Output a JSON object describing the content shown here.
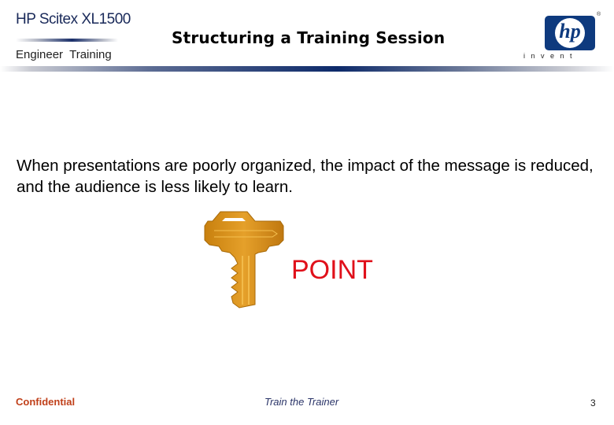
{
  "header": {
    "product_name": "HP Scitex XL1500",
    "subtitle": "Engineer  Training",
    "title": "Structuring a Training Session",
    "logo": {
      "mark": "hp",
      "tagline": "invent",
      "registered": "®",
      "color": "#0e3a7e"
    }
  },
  "body": {
    "text": "When presentations are poorly organized, the impact of the message is reduced, and the audience is less likely to learn.",
    "illustration": {
      "icon": "key-icon",
      "label": "POINT",
      "label_color": "#e0101a"
    }
  },
  "footer": {
    "left": "Confidential",
    "center": "Train the Trainer",
    "page_number": "3"
  }
}
